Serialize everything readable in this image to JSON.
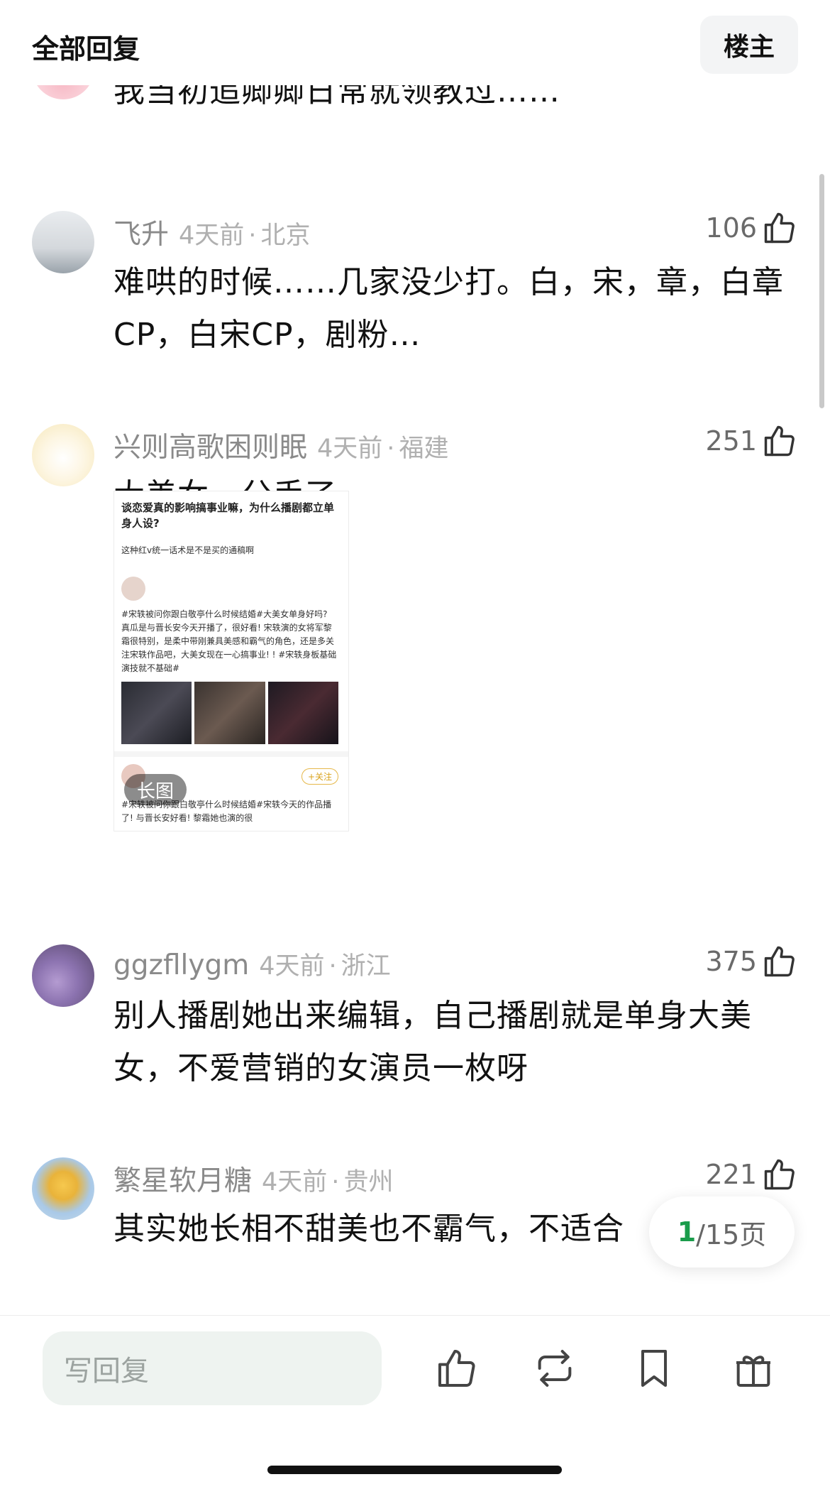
{
  "header": {
    "title": "全部回复",
    "op_button": "楼主"
  },
  "comments": [
    {
      "text": "我当初追卿卿日常就领教过……"
    },
    {
      "name": "飞升",
      "time": "4天前",
      "location": "北京",
      "likes": "106",
      "text": "难哄的时候……几家没少打。白，宋，章，白章CP，白宋CP，剧粉…"
    },
    {
      "name": "兴则高歌困则眠",
      "time": "4天前",
      "location": "福建",
      "likes": "251",
      "text": "大美女，分手了",
      "image": {
        "badge": "长图",
        "title": "谈恋爱真的影响搞事业嘛，为什么播剧都立单身人设?",
        "subtitle": "这种红v统一话术是不是买的通稿啊",
        "post1": "#宋轶被问你跟白敬亭什么时候结婚#大美女单身好吗? 真瓜是与晋长安今天开播了，很好看! 宋轶演的女将军黎霜很特别，是柔中带刚兼具美感和霸气的角色，还是多关注宋轶作品吧，大美女现在一心搞事业! ! #宋轶身板基础演技就不基础#",
        "follow": "+关注",
        "post2": "#宋轶被问你跟白敬亭什么时候结婚#宋轶今天的作品播了! 与晋长安好看! 黎霜她也演的很"
      }
    },
    {
      "name": "ggzfllygm",
      "time": "4天前",
      "location": "浙江",
      "likes": "375",
      "text": "别人播剧她出来编辑，自己播剧就是单身大美女，不爱营销的女演员一枚呀"
    },
    {
      "name": "繁星软月糖",
      "time": "4天前",
      "location": "贵州",
      "likes": "221",
      "text": "其实她长相不甜美也不霸气，不适合"
    }
  ],
  "pager": {
    "current": "1",
    "total": "/15页"
  },
  "bottom_bar": {
    "reply_placeholder": "写回复"
  }
}
